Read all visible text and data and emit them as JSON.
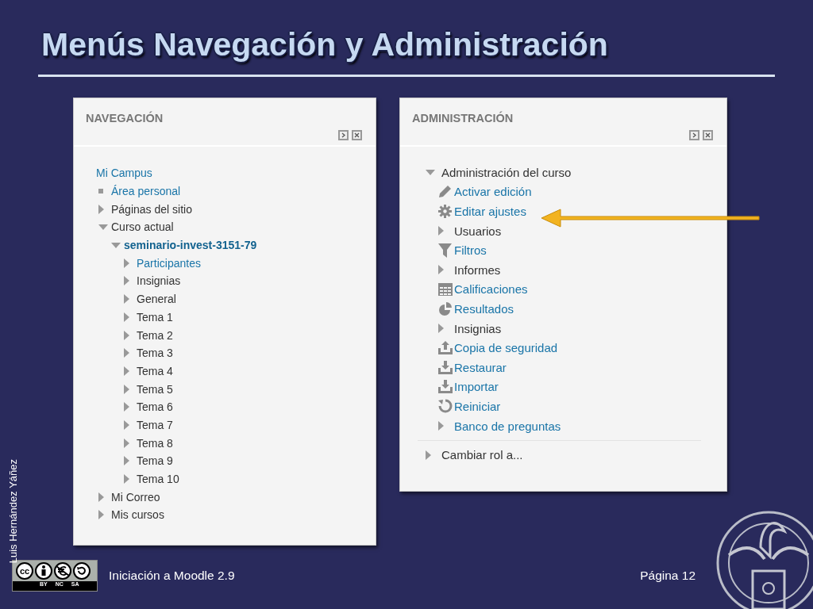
{
  "slide": {
    "title": "Menús Navegación y Administración",
    "author": "Luis Hernández Yáñez",
    "footer": "Iniciación a Moodle 2.9",
    "page": "Página 12",
    "license_badge": {
      "symbol": "cc",
      "labels": [
        "BY",
        "NC",
        "SA"
      ]
    }
  },
  "navigation": {
    "title": "NAVEGACIÓN",
    "items": [
      {
        "label": "Mi Campus",
        "kind": "root",
        "link": true,
        "children": [
          {
            "label": "Área personal",
            "kind": "leaf",
            "link": true
          },
          {
            "label": "Páginas del sitio",
            "kind": "branch",
            "expanded": false,
            "link": false
          },
          {
            "label": "Curso actual",
            "kind": "branch",
            "expanded": true,
            "link": false,
            "children": [
              {
                "label": "seminario-invest-3151-79",
                "kind": "branch",
                "expanded": true,
                "link": true,
                "current": true,
                "children": [
                  {
                    "label": "Participantes",
                    "kind": "branch",
                    "expanded": false,
                    "link": true
                  },
                  {
                    "label": "Insignias",
                    "kind": "branch",
                    "expanded": false,
                    "link": false
                  },
                  {
                    "label": "General",
                    "kind": "branch",
                    "expanded": false,
                    "link": false
                  },
                  {
                    "label": "Tema 1",
                    "kind": "branch",
                    "expanded": false,
                    "link": false
                  },
                  {
                    "label": "Tema 2",
                    "kind": "branch",
                    "expanded": false,
                    "link": false
                  },
                  {
                    "label": "Tema 3",
                    "kind": "branch",
                    "expanded": false,
                    "link": false
                  },
                  {
                    "label": "Tema 4",
                    "kind": "branch",
                    "expanded": false,
                    "link": false
                  },
                  {
                    "label": "Tema 5",
                    "kind": "branch",
                    "expanded": false,
                    "link": false
                  },
                  {
                    "label": "Tema 6",
                    "kind": "branch",
                    "expanded": false,
                    "link": false
                  },
                  {
                    "label": "Tema 7",
                    "kind": "branch",
                    "expanded": false,
                    "link": false
                  },
                  {
                    "label": "Tema 8",
                    "kind": "branch",
                    "expanded": false,
                    "link": false
                  },
                  {
                    "label": "Tema 9",
                    "kind": "branch",
                    "expanded": false,
                    "link": false
                  },
                  {
                    "label": "Tema 10",
                    "kind": "branch",
                    "expanded": false,
                    "link": false
                  }
                ]
              }
            ]
          },
          {
            "label": "Mi Correo",
            "kind": "branch",
            "expanded": false,
            "link": false
          },
          {
            "label": "Mis cursos",
            "kind": "branch",
            "expanded": false,
            "link": false
          }
        ]
      }
    ]
  },
  "administration": {
    "title": "ADMINISTRACIÓN",
    "items": [
      {
        "label": "Administración del curso",
        "kind": "branch",
        "expanded": true,
        "link": false,
        "children": [
          {
            "label": "Activar edición",
            "kind": "pencil",
            "link": true
          },
          {
            "label": "Editar ajustes",
            "kind": "gear",
            "link": true,
            "highlighted": true
          },
          {
            "label": "Usuarios",
            "kind": "branch",
            "expanded": false,
            "link": false
          },
          {
            "label": "Filtros",
            "kind": "filter",
            "link": true
          },
          {
            "label": "Informes",
            "kind": "branch",
            "expanded": false,
            "link": false
          },
          {
            "label": "Calificaciones",
            "kind": "table",
            "link": true
          },
          {
            "label": "Resultados",
            "kind": "pie",
            "link": true
          },
          {
            "label": "Insignias",
            "kind": "branch",
            "expanded": false,
            "link": false
          },
          {
            "label": "Copia de seguridad",
            "kind": "upload",
            "link": true
          },
          {
            "label": "Restaurar",
            "kind": "download",
            "link": true
          },
          {
            "label": "Importar",
            "kind": "download",
            "link": true
          },
          {
            "label": "Reiniciar",
            "kind": "reset",
            "link": true
          },
          {
            "label": "Banco de preguntas",
            "kind": "branch",
            "expanded": false,
            "link": true
          }
        ]
      },
      {
        "label": "Cambiar rol a...",
        "kind": "branch",
        "expanded": false,
        "link": false
      }
    ]
  }
}
